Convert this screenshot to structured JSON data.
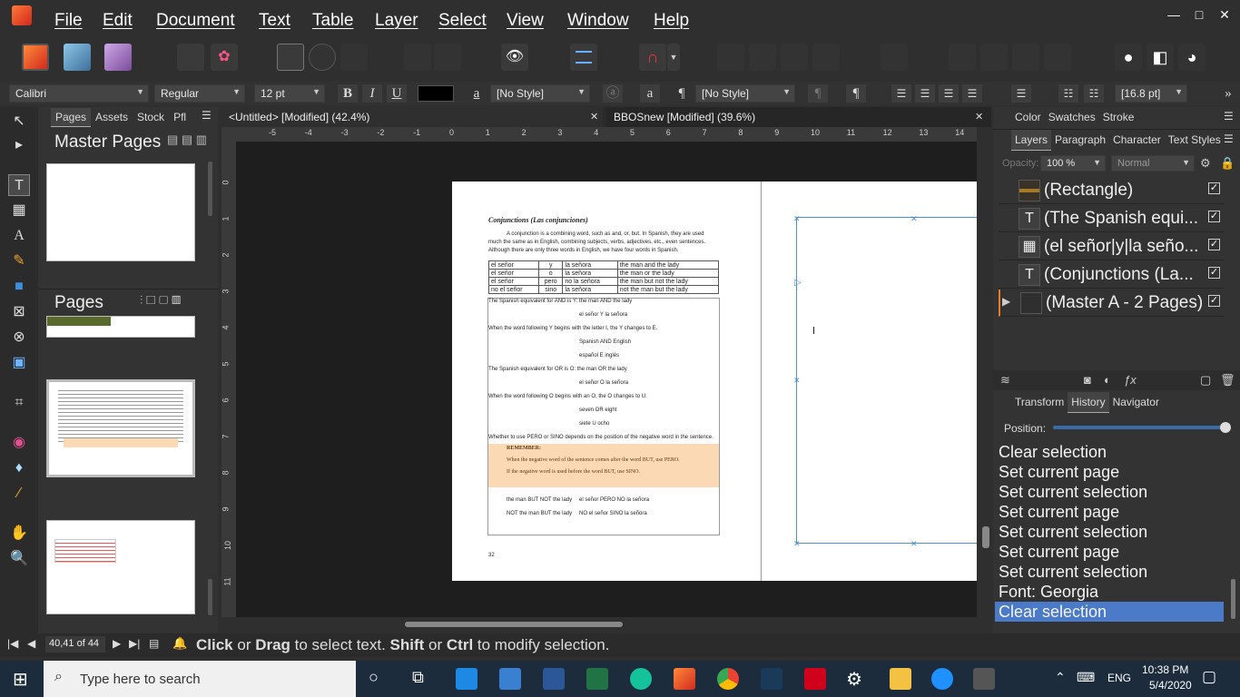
{
  "menu": {
    "items": [
      "File",
      "Edit",
      "Document",
      "Text",
      "Table",
      "Layer",
      "Select",
      "View",
      "Window",
      "Help"
    ]
  },
  "window_controls": {
    "minimize": "—",
    "maximize": "□",
    "close": "✕"
  },
  "context_toolbar": {
    "font_family": "Calibri",
    "font_style": "Regular",
    "font_size": "12 pt",
    "bold": "B",
    "italic": "I",
    "underline": "U",
    "char_style": "[No Style]",
    "para_style": "[No Style]",
    "leading": "[16.8 pt]",
    "char_glyph": "a",
    "para_glyph": "¶",
    "more": "»"
  },
  "pages_panel": {
    "tabs": [
      "Pages",
      "Assets",
      "Stock",
      "Pfl"
    ],
    "master_title": "Master Pages",
    "pages_title": "Pages"
  },
  "document_tabs": [
    {
      "label": "<Untitled> [Modified] (42.4%)",
      "close": "✕"
    },
    {
      "label": "BBOSnew [Modified] (39.6%)",
      "close": "✕"
    }
  ],
  "ruler": {
    "h_labels": [
      "-5",
      "-4",
      "-3",
      "-2",
      "-1",
      "0",
      "1",
      "2",
      "3",
      "4",
      "5",
      "6",
      "7",
      "8",
      "9",
      "10",
      "11",
      "12",
      "13",
      "14"
    ],
    "v_labels": [
      "0",
      "1",
      "2",
      "3",
      "4",
      "5",
      "6",
      "7",
      "8",
      "9",
      "10",
      "11"
    ]
  },
  "doc_page": {
    "title": "Conjunctions  (Las conjunciones)",
    "intro1": "A conjunction is a combining word, such as and, or, but. In Spanish, they are used",
    "intro2": "much the same as in English, combining subjects, verbs, adjectives, etc., even sentences.",
    "intro3": "Although there are only three words in English, we have four words in Spanish.",
    "table": [
      [
        "el señor",
        "y",
        "la señora",
        "the man and the lady"
      ],
      [
        "el señor",
        "o",
        "la señora",
        "the man or the lady"
      ],
      [
        "el señor",
        "pero",
        "no la señora",
        "the man but not the lady"
      ],
      [
        "no el señor",
        "sino",
        "la señora",
        "not the man but the lady"
      ]
    ],
    "lines": [
      "The Spanish equivalent for AND is Y:  the man AND the lady",
      "el señor Y la señora",
      "When the word following Y begins with the letter I, the Y changes to E.",
      "Spanish AND English",
      "español E inglés",
      "The Spanish equivalent for OR is O:   the man OR the lady",
      "el señor O la señora",
      "When the word following O begins with an O, the O changes to U.",
      "seven OR eight",
      "siete U ocho",
      "Whether to use PERO or SINO depends on the position of the negative word in the sentence."
    ],
    "remember_title": "REMEMBER:",
    "remember1": "When the negative word of the sentence comes after the word BUT, use PERO.",
    "remember2": "If the negative word is used before the word BUT, use SINO.",
    "ex1a": "the man BUT NOT the lady",
    "ex1b": "el señor PERO NO la señora",
    "ex2a": "NOT the man BUT the lady",
    "ex2b": "NO el señor SINO la señora",
    "page_number": "32"
  },
  "right_panel": {
    "top_tabs": [
      "Color",
      "Swatches",
      "Stroke"
    ],
    "layer_tabs": [
      "Layers",
      "Paragraph",
      "Character",
      "Text Styles"
    ],
    "opacity_label": "Opacity:",
    "opacity": "100 %",
    "blend": "Normal",
    "layers": [
      {
        "name": "(Rectangle)"
      },
      {
        "name": "(The Spanish equi..."
      },
      {
        "name": "(el señor|y|la seño..."
      },
      {
        "name": "(Conjunctions  (La..."
      },
      {
        "name": "(Master A - 2 Pages)"
      }
    ],
    "checkmark": "✓",
    "bottom_tabs": [
      "Transform",
      "History",
      "Navigator"
    ],
    "position_label": "Position:",
    "history_position": 1.0,
    "history": [
      "Clear selection",
      "Set current page",
      "Set current selection",
      "Set current page",
      "Set current selection",
      "Set current page",
      "Set current selection",
      "Font: Georgia",
      "Clear selection"
    ]
  },
  "status": {
    "page_indicator": "40,41 of 44",
    "hint_click": "Click",
    "hint_or1": " or ",
    "hint_drag": "Drag",
    "hint_mid": " to select text. ",
    "hint_shift": "Shift",
    "hint_or2": " or ",
    "hint_ctrl": "Ctrl",
    "hint_end": " to modify selection."
  },
  "taskbar": {
    "search_placeholder": "Type here to search",
    "lang": "ENG",
    "time": "10:38 PM",
    "date": "5/4/2020"
  },
  "colors": {
    "accent": "#4a90d9",
    "history_highlight": "#4a7ac8",
    "remember_bg": "#fbd9b4"
  }
}
